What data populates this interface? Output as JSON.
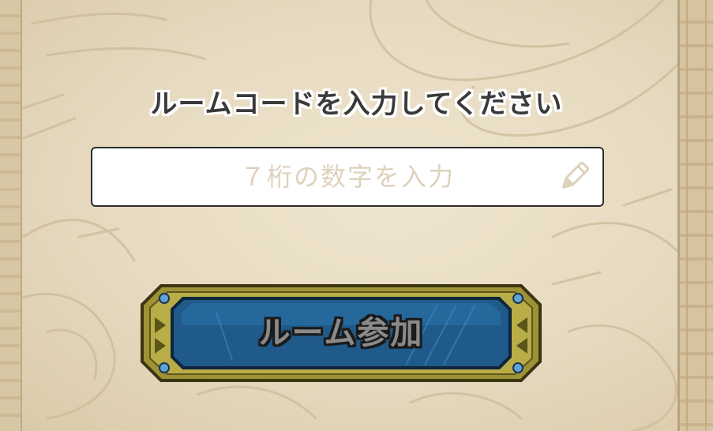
{
  "dialog": {
    "title": "ルームコードを入力してください",
    "input": {
      "placeholder": "７桁の数字を入力",
      "value": ""
    },
    "join_button_label": "ルーム参加"
  },
  "icons": {
    "input_icon": "pencil-icon"
  },
  "colors": {
    "parchment": "#e8dcc4",
    "button_blue": "#1f5a8a",
    "button_frame_gold": "#a89a3a",
    "placeholder_text": "#ddd2bc"
  }
}
